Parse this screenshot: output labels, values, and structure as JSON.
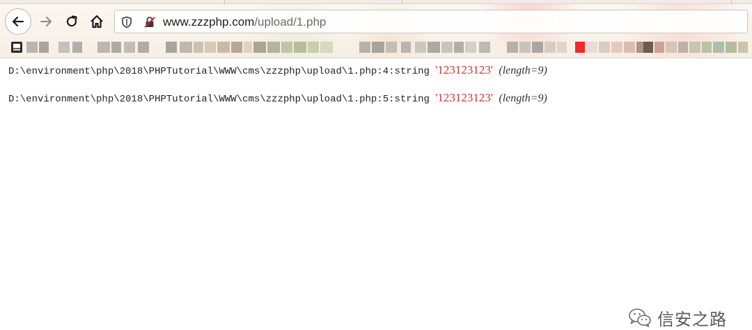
{
  "browser": {
    "url_host": "www.zzzphp.com",
    "url_path": "/upload/1.php",
    "icons": {
      "back": "back-arrow-icon",
      "forward": "forward-arrow-icon",
      "reload": "reload-icon",
      "home": "home-icon",
      "shield": "shield-icon",
      "lock": "insecure-connection-icon",
      "bookmark": "bookmark-folder-icon"
    }
  },
  "dump": [
    {
      "path": "D:\\environment\\php\\2018\\PHPTutorial\\WWW\\cms\\zzzphp\\upload\\1.php:4:",
      "type": "string",
      "value": "'123123123'",
      "length": "(length=9)"
    },
    {
      "path": "D:\\environment\\php\\2018\\PHPTutorial\\WWW\\cms\\zzzphp\\upload\\1.php:5:",
      "type": "string",
      "value": "'123123123'",
      "length": "(length=9)"
    }
  ],
  "watermark": {
    "text": "信安之路",
    "icon": "wechat-icon"
  },
  "colors": {
    "string_value": "#cc3333",
    "text": "#222222"
  }
}
